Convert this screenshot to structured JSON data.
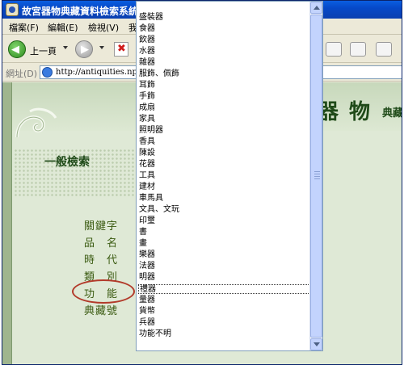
{
  "window": {
    "title": "故宮器物典藏資料檢索系統"
  },
  "menu": [
    "檔案(F)",
    "編輯(E)",
    "檢視(V)",
    "我"
  ],
  "toolbar": {
    "back_label": "上一頁"
  },
  "address": {
    "label": "網址(D)",
    "url": "http://antiquities.npm.gov"
  },
  "page": {
    "banner_title": "器 物",
    "banner_sub": "典藏",
    "section_title": "一般檢索",
    "fields": [
      "關鍵字",
      "品　名",
      "時　代",
      "類　別",
      "功　能",
      "典藏號"
    ]
  },
  "dropdown": {
    "selected": "",
    "options": [
      "盛裝器",
      "食器",
      "飲器",
      "水器",
      "雜器",
      "服飾、佩飾",
      "耳飾",
      "手飾",
      "成扇",
      "家具",
      "照明器",
      "香具",
      "陳設",
      "花器",
      "工具",
      "建材",
      "車馬具",
      "文具、文玩",
      "印璽",
      "書",
      "畫",
      "樂器",
      "法器",
      "明器",
      "禮器",
      "量器",
      "貨幣",
      "兵器",
      "功能不明"
    ]
  }
}
